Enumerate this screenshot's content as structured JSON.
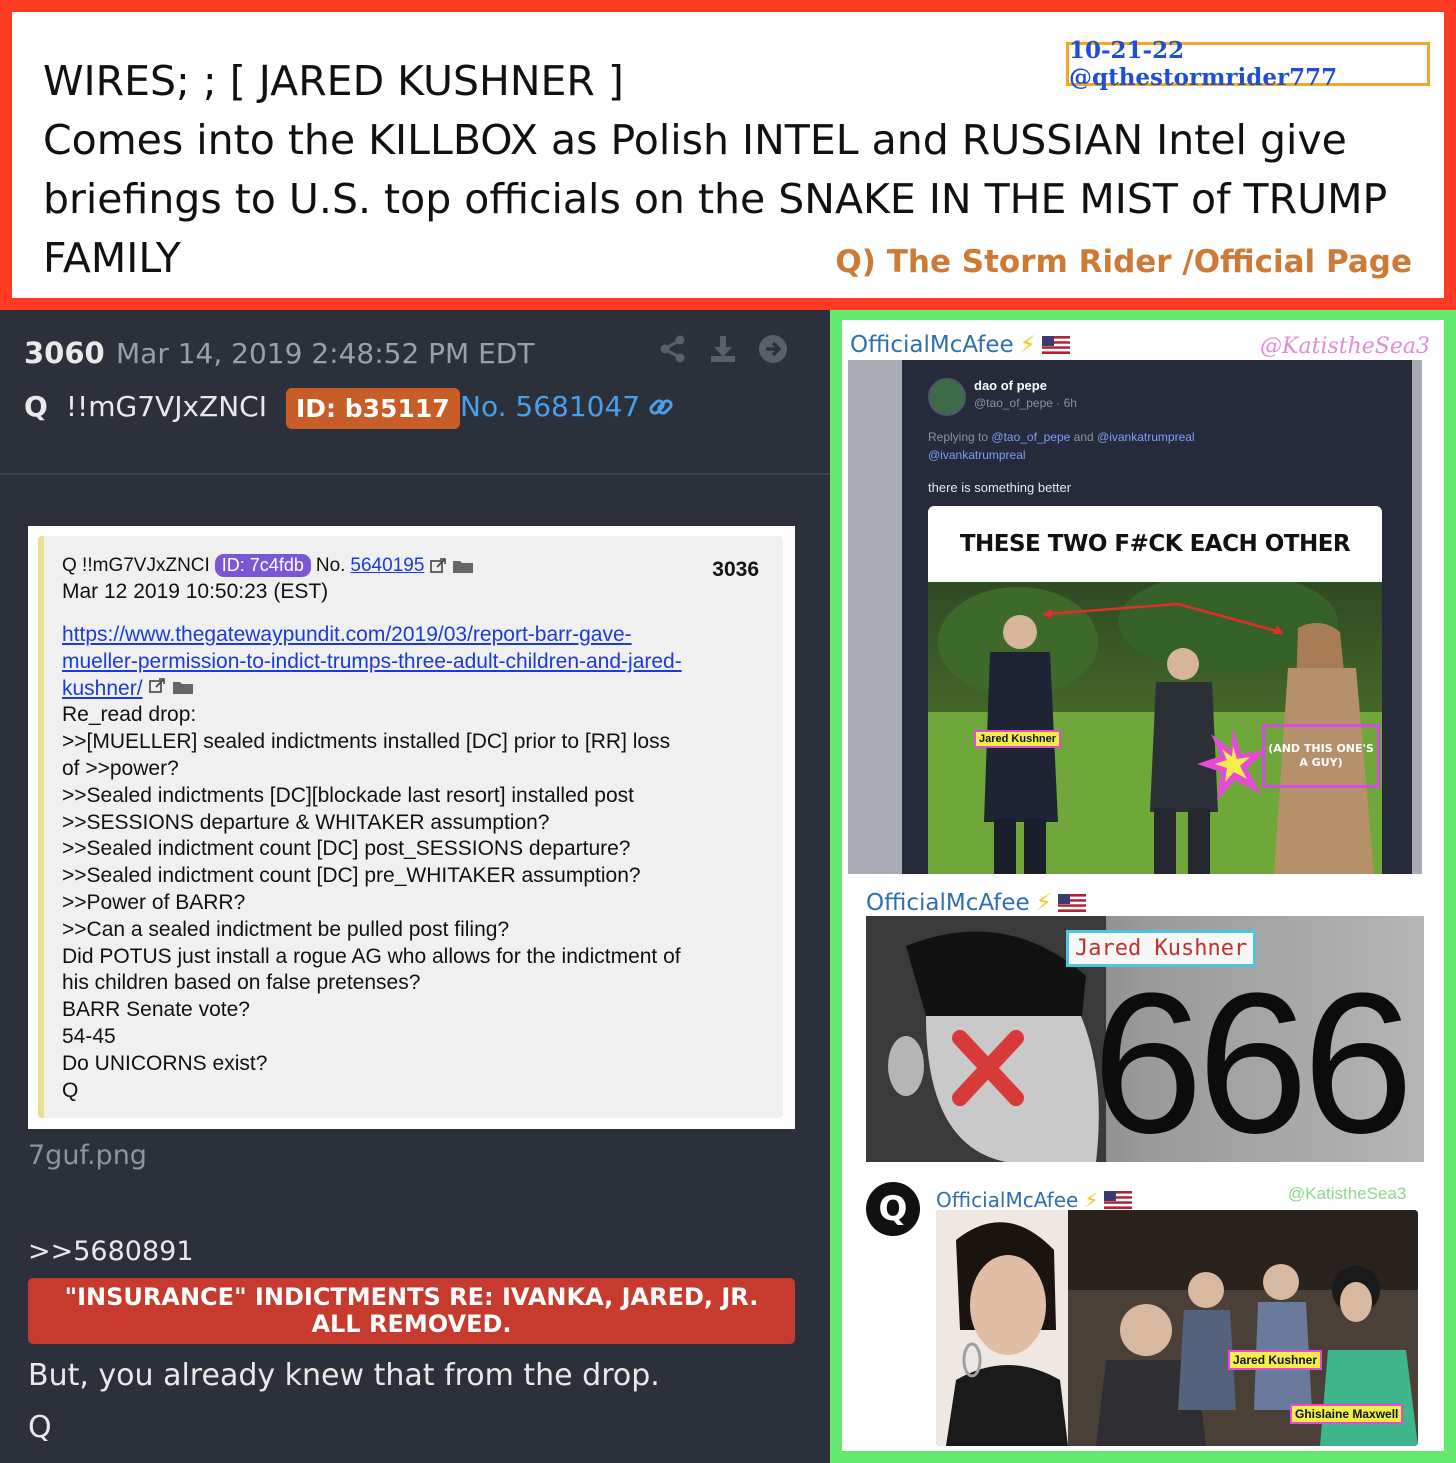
{
  "header": {
    "date_badge": "10-21-22 @qthestormrider777",
    "lines": [
      "WIRES; ; [ JARED KUSHNER ]",
      "Comes into the KILLBOX as Polish INTEL and RUSSIAN Intel give",
      "briefings to U.S. top officials on the SNAKE IN THE MIST of TRUMP",
      "FAMILY"
    ],
    "credit": "Q) The Storm Rider /Official Page",
    "colors": {
      "border": "#ff3b23",
      "badge_border": "#f5a623",
      "badge_text": "#1d4fd8",
      "credit": "#cd7a36"
    }
  },
  "qpost": {
    "number": "3060",
    "date": "Mar 14, 2019 2:48:52 PM EDT",
    "icons": [
      "share-icon",
      "download-icon",
      "forward-icon"
    ],
    "author_letter": "Q",
    "tripcode": "!!mG7VJxZNCI",
    "id_label": "ID: b35117",
    "post_no": "No. 5681047",
    "quoted": {
      "author": "Q !!mG7VJxZNCI",
      "id_label": "ID: 7c4fdb",
      "no_prefix": "No.",
      "no_link": "5640195",
      "number": "3036",
      "date": "Mar 12 2019 10:50:23 (EST)",
      "link_lines": [
        "https://www.thegatewaypundit.com/2019/03/report-barr-gave-",
        "mueller-permission-to-indict-trumps-three-adult-children-and-jared-",
        "kushner/"
      ],
      "lines": [
        "Re_read drop:",
        ">>[MUELLER] sealed indictments installed [DC] prior to [RR] loss",
        "of >>power?",
        ">>Sealed indictments [DC][blockade last resort] installed post",
        ">>SESSIONS departure & WHITAKER assumption?",
        ">>Sealed indictment count [DC] post_SESSIONS departure?",
        ">>Sealed indictment count [DC] pre_WHITAKER assumption?",
        ">>Power of BARR?",
        ">>Can a sealed indictment be pulled post filing?",
        "Did POTUS just install a rogue AG who allows for the indictment of",
        "his children based on false pretenses?",
        "BARR Senate vote?",
        "54-45",
        "Do UNICORNS exist?",
        "Q"
      ]
    },
    "filename": "7guf.png",
    "reply_ref": ">>5680891",
    "banner": "\"INSURANCE\" INDICTMENTS RE: IVANKA, JARED, JR. ALL REMOVED.",
    "text": "But, you already knew that from the drop.",
    "signature": "Q",
    "colors": {
      "background": "#2b303a",
      "id_badge": "#c85d27",
      "post_no": "#4a9eea",
      "banner": "#c73a2e"
    }
  },
  "collage": {
    "watermark_top": "@KatistheSea3",
    "posts": [
      {
        "author": "OfficialMcAfee",
        "bolt": "⚡",
        "flag": "us-flag-icon"
      },
      {
        "author": "OfficialMcAfee",
        "bolt": "⚡",
        "flag": "us-flag-icon"
      },
      {
        "author": "OfficialMcAfee",
        "bolt": "⚡",
        "flag": "us-flag-icon"
      }
    ],
    "tweet": {
      "name": "dao of pepe",
      "handle": "@tao_of_pepe · 6h",
      "reply_prefix": "Replying to",
      "reply_mention_1": "@tao_of_pepe",
      "reply_and": "and",
      "reply_mention_2": "@ivankatrumpreal",
      "reply_mention_3": "@ivankatrumpreal",
      "text": "there is something better",
      "meme_title": "THESE TWO F#CK EACH OTHER",
      "label_jared": "Jared Kushner",
      "label_guy": "(AND THIS ONE'S A GUY)"
    },
    "card666": {
      "label": "Jared Kushner",
      "number": "666"
    },
    "third": {
      "logo": "Q",
      "watermark": "@KatistheSea3",
      "label_jared": "Jared Kushner",
      "label_ghislaine": "Ghislaine Maxwell"
    },
    "colors": {
      "border": "#63ea6e",
      "author": "#2f6fb0",
      "watermark": "#e58ad4"
    }
  }
}
